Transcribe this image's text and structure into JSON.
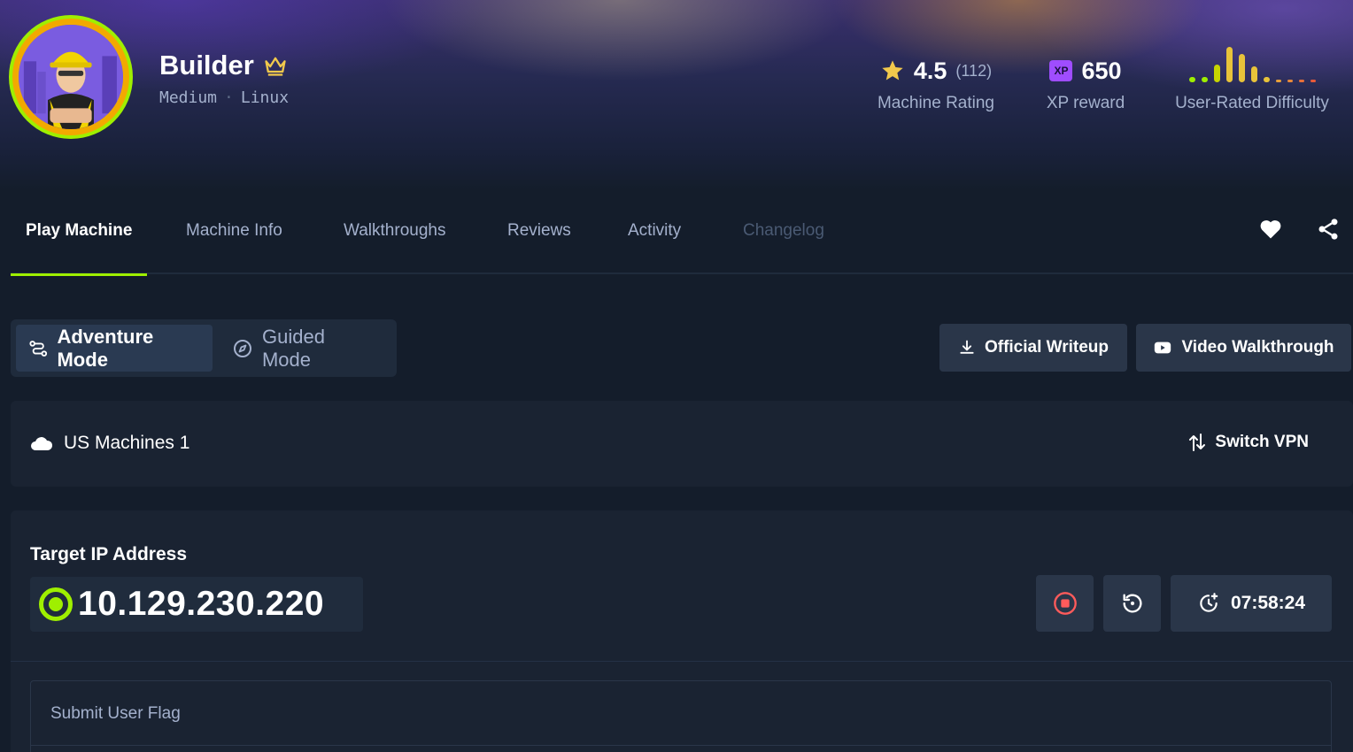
{
  "machine": {
    "name": "Builder",
    "difficulty": "Medium",
    "separator": "·",
    "os": "Linux"
  },
  "stats": {
    "rating": {
      "value": "4.5",
      "count": "(112)",
      "label": "Machine Rating"
    },
    "xp": {
      "badge": "XP",
      "value": "650",
      "label": "XP reward"
    },
    "difficulty": {
      "label": "User-Rated Difficulty",
      "bars": [
        0.1,
        0.15,
        0.5,
        1.0,
        0.8,
        0.45,
        0.1,
        0.05,
        0.05,
        0.05,
        0.05
      ],
      "bar_colors": [
        "#9fef00",
        "#9fef00",
        "#c7d400",
        "#e8c33a",
        "#e8c33a",
        "#e8c33a",
        "#e8c33a",
        "#e8a03a",
        "#e88a3a",
        "#e8703a",
        "#e85a3a"
      ]
    }
  },
  "tabs": [
    {
      "label": "Play Machine",
      "state": "active"
    },
    {
      "label": "Machine Info",
      "state": "normal"
    },
    {
      "label": "Walkthroughs",
      "state": "normal"
    },
    {
      "label": "Reviews",
      "state": "normal"
    },
    {
      "label": "Activity",
      "state": "normal"
    },
    {
      "label": "Changelog",
      "state": "disabled"
    }
  ],
  "modes": {
    "adventure": "Adventure Mode",
    "guided": "Guided Mode"
  },
  "actions": {
    "writeup": "Official Writeup",
    "video": "Video Walkthrough"
  },
  "vpn": {
    "server": "US Machines 1",
    "switch_label": "Switch VPN"
  },
  "target": {
    "label": "Target IP Address",
    "ip": "10.129.230.220",
    "timer": "07:58:24"
  },
  "flag": {
    "user_label": "Submit User Flag"
  },
  "colors": {
    "accent": "#9fef00",
    "background": "#141d2b",
    "panel": "#1a2332",
    "star": "#f2c94c",
    "xp_badge": "#9f4dff",
    "stop": "#ff5b5b"
  }
}
